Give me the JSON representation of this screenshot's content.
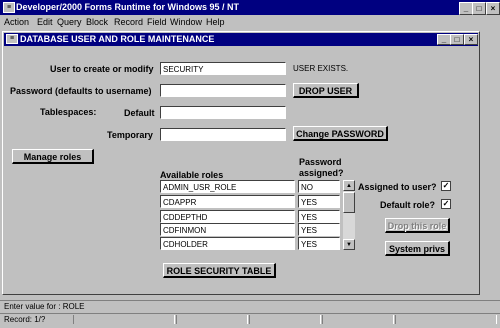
{
  "app": {
    "title": "Developer/2000 Forms Runtime for Windows 95 / NT"
  },
  "menu": [
    "Action",
    "Edit",
    "Query",
    "Block",
    "Record",
    "Field",
    "Window",
    "Help"
  ],
  "form": {
    "title": "DATABASE USER AND ROLE MAINTENANCE",
    "user_label": "User to create or modify",
    "user_value": "SECURITY",
    "user_status": "USER EXISTS.",
    "password_label": "Password (defaults to username)",
    "password_value": "",
    "tablespaces_label": "Tablespaces:",
    "default_label": "Default",
    "default_value": "",
    "temporary_label": "Temporary",
    "temporary_value": "",
    "drop_user_label": "DROP USER",
    "change_password_label": "Change PASSWORD",
    "manage_roles_label": "Manage roles",
    "roles": {
      "col_available": "Available roles",
      "col_password_1": "Password",
      "col_password_2": "assigned?",
      "rows": [
        {
          "role": "ADMIN_USR_ROLE",
          "assigned": "NO"
        },
        {
          "role": "CDAPPR",
          "assigned": "YES"
        },
        {
          "role": "CDDEPTHD",
          "assigned": "YES"
        },
        {
          "role": "CDFINMON",
          "assigned": "YES"
        },
        {
          "role": "CDHOLDER",
          "assigned": "YES"
        }
      ]
    },
    "assigned_to_user_label": "Assigned to user?",
    "default_role_label": "Default role?",
    "drop_role_label": "Drop this role",
    "system_privs_label": "System privs",
    "role_security_table_label": "ROLE SECURITY TABLE"
  },
  "status": {
    "message": "Enter value for : ROLE",
    "record": "Record: 1/?"
  }
}
